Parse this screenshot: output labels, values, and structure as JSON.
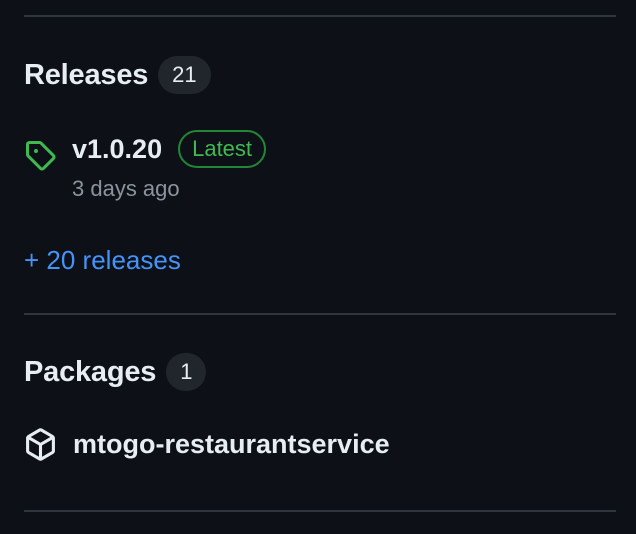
{
  "releases": {
    "title": "Releases",
    "count": "21",
    "latest": {
      "name": "v1.0.20",
      "badge": "Latest",
      "time": "3 days ago"
    },
    "more_link": "+ 20 releases"
  },
  "packages": {
    "title": "Packages",
    "count": "1",
    "items": [
      {
        "name": "mtogo-restaurantservice",
        "icon": "package-icon"
      }
    ]
  },
  "colors": {
    "background": "#0d1117",
    "text": "#e6edf3",
    "muted": "#8b949e",
    "accent_link": "#4493f8",
    "success": "#3fb950",
    "success_border": "#238636",
    "divider": "#30363d",
    "counter_bg": "#21262d"
  },
  "icons": {
    "release": "tag-icon",
    "package": "package-icon"
  }
}
